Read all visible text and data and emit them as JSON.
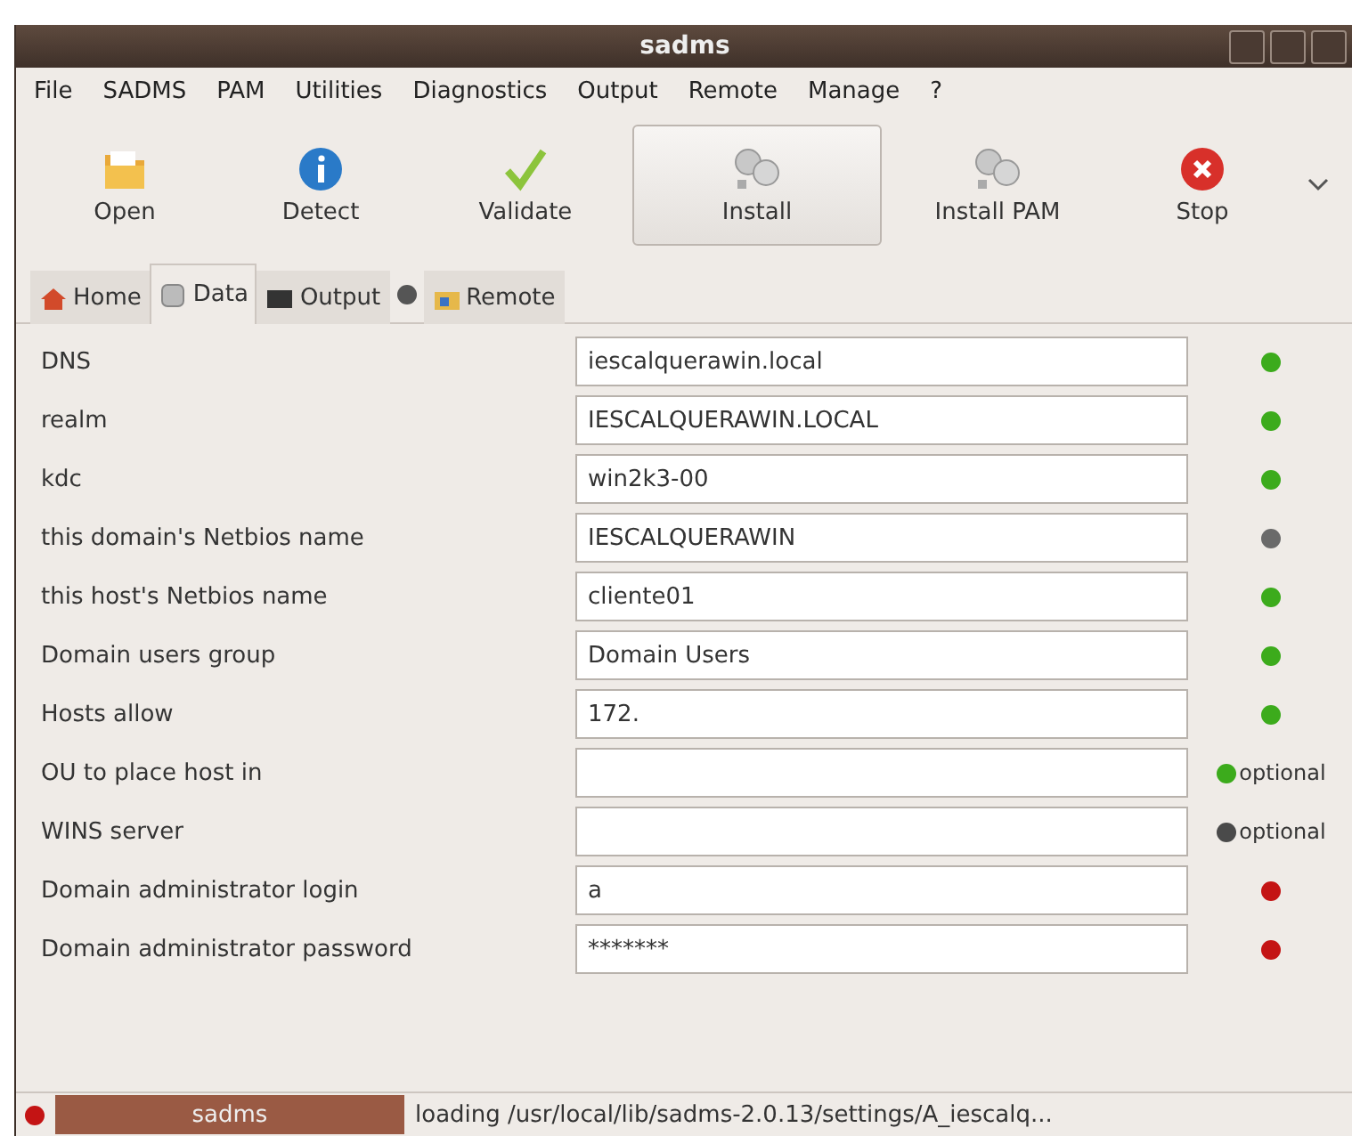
{
  "window": {
    "title": "sadms"
  },
  "menu": [
    "File",
    "SADMS",
    "PAM",
    "Utilities",
    "Diagnostics",
    "Output",
    "Remote",
    "Manage",
    "?"
  ],
  "toolbar": [
    {
      "label": "Open",
      "selected": false
    },
    {
      "label": "Detect",
      "selected": false
    },
    {
      "label": "Validate",
      "selected": false
    },
    {
      "label": "Install",
      "selected": true
    },
    {
      "label": "Install PAM",
      "selected": false
    },
    {
      "label": "Stop",
      "selected": false
    }
  ],
  "tabs": [
    {
      "label": "Home",
      "selected": false
    },
    {
      "label": "Data",
      "selected": true
    },
    {
      "label": "Output",
      "selected": false
    },
    {
      "label": "Remote",
      "selected": false
    }
  ],
  "rows": [
    {
      "label": "DNS",
      "value": "iescalquerawin.local",
      "color": "#3cab1c"
    },
    {
      "label": "realm",
      "value": "IESCALQUERAWIN.LOCAL",
      "color": "#3cab1c"
    },
    {
      "label": "kdc",
      "value": "win2k3-00",
      "color": "#3cab1c"
    },
    {
      "label": "this domain's Netbios name",
      "value": "IESCALQUERAWIN",
      "color": "#6a6a6a"
    },
    {
      "label": "this host's Netbios name",
      "value": "cliente01",
      "color": "#3cab1c"
    },
    {
      "label": "Domain users group",
      "value": "Domain Users",
      "color": "#3cab1c"
    },
    {
      "label": "Hosts allow",
      "value": "172.",
      "color": "#3cab1c"
    },
    {
      "label": "OU to place host in",
      "value": "",
      "color": "#3cab1c",
      "note": "optional"
    },
    {
      "label": "WINS server",
      "value": "",
      "color": "#4a4a4a",
      "note": "optional"
    },
    {
      "label": "Domain administrator login",
      "value": "a",
      "color": "#c41414"
    },
    {
      "label": "Domain administrator password",
      "value": "*******",
      "color": "#c41414"
    }
  ],
  "status_bar": {
    "color": "#c41414",
    "name": "sadms",
    "message": "loading /usr/local/lib/sadms-2.0.13/settings/A_iescalq..."
  }
}
